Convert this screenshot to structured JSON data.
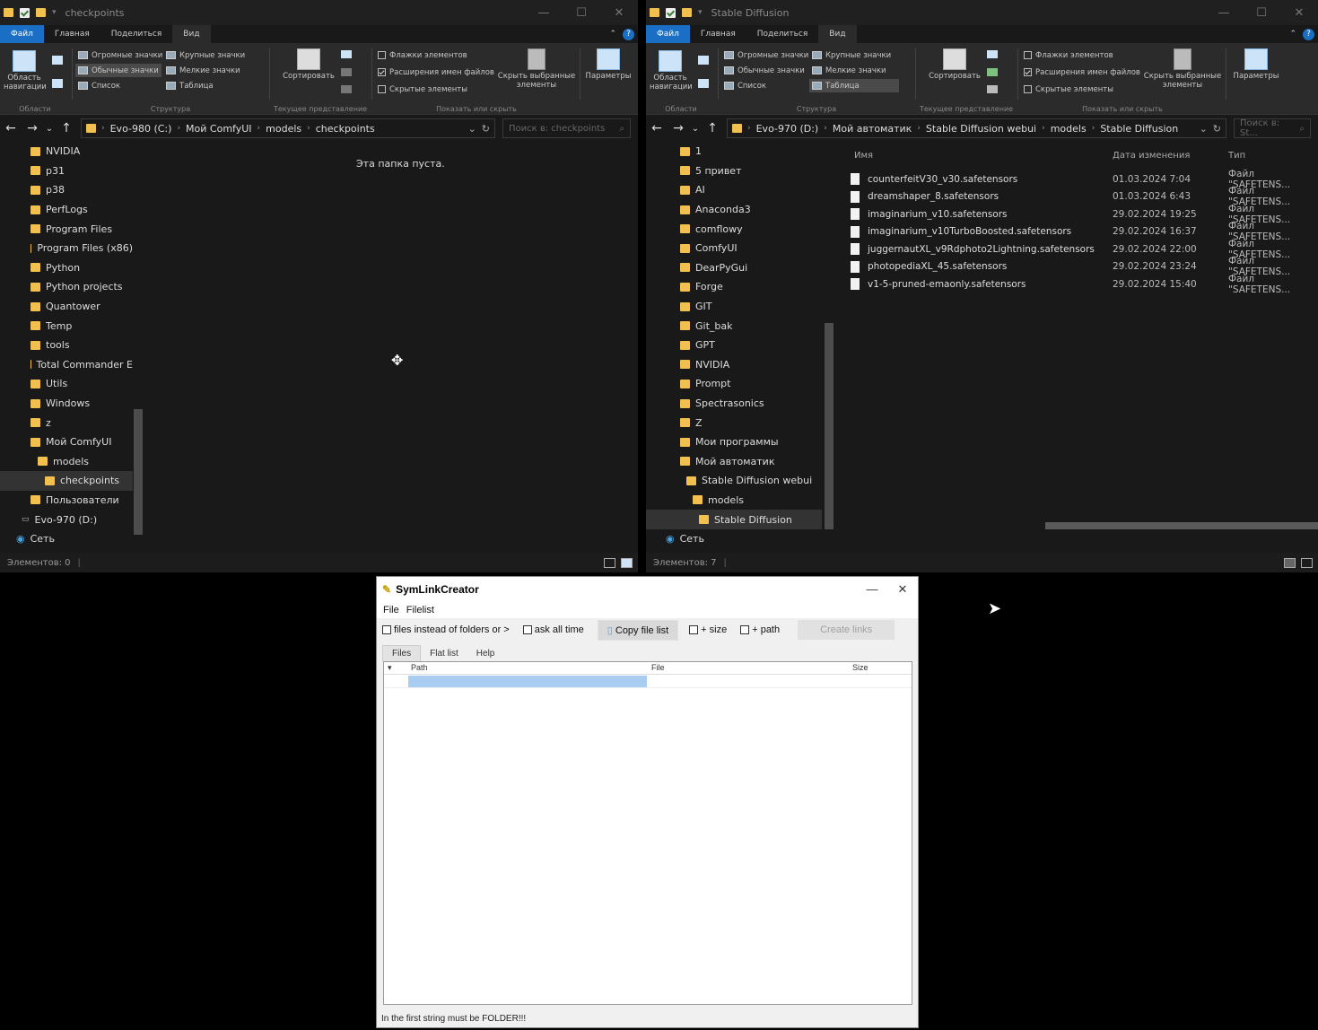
{
  "left_window": {
    "title": "checkpoints",
    "tabs": [
      "Файл",
      "Главная",
      "Поделиться",
      "Вид"
    ],
    "ribbon": {
      "nav_pane": "Область навигации",
      "layout_items": [
        "Огромные значки",
        "Крупные значки",
        "Обычные значки",
        "Мелкие значки",
        "Список",
        "Таблица"
      ],
      "sort": "Сортировать",
      "checks": [
        "Флажки элементов",
        "Расширения имен файлов",
        "Скрытые элементы"
      ],
      "hide_selected": "Скрыть выбранные элементы",
      "options": "Параметры",
      "groups": [
        "Области",
        "Структура",
        "Текущее представление",
        "Показать или скрыть"
      ]
    },
    "path": [
      "Evo-980 (C:)",
      "Мой ComfyUI",
      "models",
      "checkpoints"
    ],
    "search_placeholder": "Поиск в: checkpoints",
    "nav_items": [
      "NVIDIA",
      "p31",
      "p38",
      "PerfLogs",
      "Program Files",
      "Program Files (x86)",
      "Python",
      "Python projects",
      "Quantower",
      "Temp",
      "tools",
      "Total Commander E",
      "Utils",
      "Windows",
      "z",
      "Мой ComfyUI",
      "models",
      "checkpoints",
      "Пользователи",
      "Evo-970 (D:)",
      "Сеть"
    ],
    "empty_text": "Эта папка пуста.",
    "status": "Элементов: 0"
  },
  "right_window": {
    "title": "Stable Diffusion",
    "tabs": [
      "Файл",
      "Главная",
      "Поделиться",
      "Вид"
    ],
    "ribbon": {
      "nav_pane": "Область навигации",
      "layout_items": [
        "Огромные значки",
        "Крупные значки",
        "Обычные значки",
        "Мелкие значки",
        "Список",
        "Таблица"
      ],
      "sort": "Сортировать",
      "checks": [
        "Флажки элементов",
        "Расширения имен файлов",
        "Скрытые элементы"
      ],
      "hide_selected": "Скрыть выбранные элементы",
      "options": "Параметры",
      "groups": [
        "Области",
        "Структура",
        "Текущее представление",
        "Показать или скрыть"
      ]
    },
    "path": [
      "Evo-970 (D:)",
      "Мой автоматик",
      "Stable Diffusion webui",
      "models",
      "Stable Diffusion"
    ],
    "search_placeholder": "Поиск в: St...",
    "nav_items": [
      "1",
      "5 привет",
      "AI",
      "Anaconda3",
      "comflowy",
      "ComfyUI",
      "DearPyGui",
      "Forge",
      "GIT",
      "Git_bak",
      "GPT",
      "NVIDIA",
      "Prompt",
      "Spectrasonics",
      "Z",
      "Мои программы",
      "Мой автоматик",
      "Stable Diffusion webui",
      "models",
      "Stable Diffusion",
      "Сеть"
    ],
    "columns": [
      "Имя",
      "Дата изменения",
      "Тип"
    ],
    "files": [
      {
        "name": "counterfeitV30_v30.safetensors",
        "date": "01.03.2024 7:04",
        "type": "Файл \"SAFETENS..."
      },
      {
        "name": "dreamshaper_8.safetensors",
        "date": "01.03.2024 6:43",
        "type": "Файл \"SAFETENS..."
      },
      {
        "name": "imaginarium_v10.safetensors",
        "date": "29.02.2024 19:25",
        "type": "Файл \"SAFETENS..."
      },
      {
        "name": "imaginarium_v10TurboBoosted.safetensors",
        "date": "29.02.2024 16:37",
        "type": "Файл \"SAFETENS..."
      },
      {
        "name": "juggernautXL_v9Rdphoto2Lightning.safetensors",
        "date": "29.02.2024 22:00",
        "type": "Файл \"SAFETENS..."
      },
      {
        "name": "photopediaXL_45.safetensors",
        "date": "29.02.2024 23:24",
        "type": "Файл \"SAFETENS..."
      },
      {
        "name": "v1-5-pruned-emaonly.safetensors",
        "date": "29.02.2024 15:40",
        "type": "Файл \"SAFETENS..."
      }
    ],
    "status": "Элементов: 7"
  },
  "symlink": {
    "title": "SymLinkCreator",
    "menu": [
      "File",
      "Filelist"
    ],
    "opt_files": "files instead of folders or >",
    "opt_ask": "ask all time",
    "copy_btn": "Copy file list",
    "opt_size": "+ size",
    "opt_path": "+ path",
    "create_btn": "Create links",
    "tabs": [
      "Files",
      "Flat list",
      "Help"
    ],
    "columns": [
      "Path",
      "File",
      "Size"
    ],
    "status": "In the first string must be FOLDER!!!"
  },
  "colors": {
    "accent": "#1a6fc4",
    "folder": "#f2c04e",
    "dark_bg": "#191919"
  }
}
